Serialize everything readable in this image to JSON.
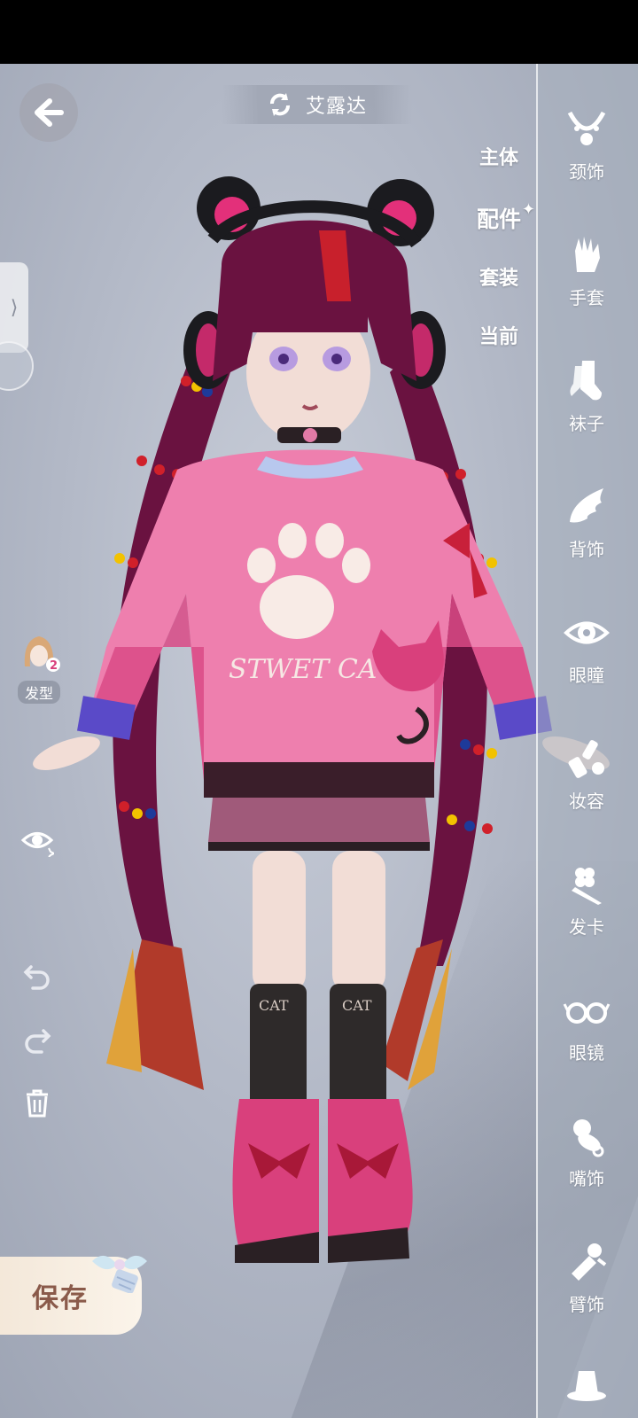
{
  "header": {
    "title": "艾露达"
  },
  "category_tabs": [
    {
      "label": "主体",
      "active": false
    },
    {
      "label": "配件",
      "active": true
    },
    {
      "label": "套装",
      "active": false
    },
    {
      "label": "当前",
      "active": false
    }
  ],
  "accessories": [
    {
      "label": "颈饰",
      "icon": "necklace-icon"
    },
    {
      "label": "手套",
      "icon": "glove-icon"
    },
    {
      "label": "袜子",
      "icon": "sock-icon"
    },
    {
      "label": "背饰",
      "icon": "wing-icon"
    },
    {
      "label": "眼瞳",
      "icon": "eye-icon"
    },
    {
      "label": "妆容",
      "icon": "makeup-icon"
    },
    {
      "label": "发卡",
      "icon": "hairpin-icon"
    },
    {
      "label": "眼镜",
      "icon": "glasses-icon"
    },
    {
      "label": "嘴饰",
      "icon": "pacifier-icon"
    },
    {
      "label": "臂饰",
      "icon": "armband-icon"
    }
  ],
  "left_tools": {
    "hairstyle_label": "发型",
    "hairstyle_badge": "2"
  },
  "save": {
    "label": "保存"
  },
  "character": {
    "sweater_text": "STWET CA",
    "sock_text": "CAT"
  },
  "colors": {
    "background": "#b3b9c7",
    "sweater_pink": "#ee7fae",
    "sweater_magenta": "#d94a86",
    "hair": "#6a1240",
    "save_text": "#8a5a4a"
  }
}
